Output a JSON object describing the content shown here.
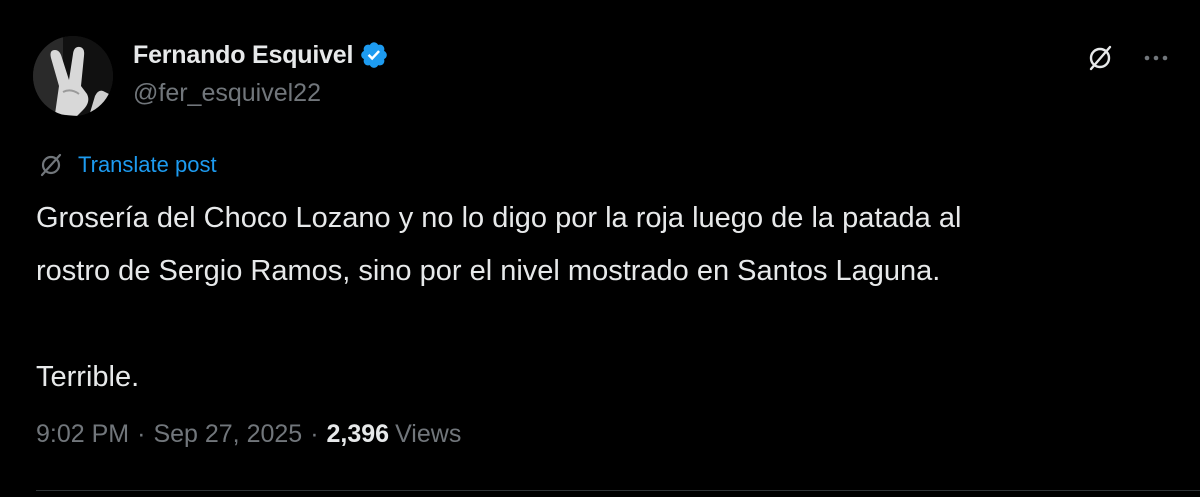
{
  "author": {
    "display_name": "Fernando Esquivel",
    "handle": "@fer_esquivel22",
    "verified": true,
    "verified_color": "#1d9bf0"
  },
  "actions": {
    "grok_icon": "grok-slash-circle-icon",
    "more_icon": "more-horizontal-icon"
  },
  "translate": {
    "label": "Translate post",
    "color": "#1d9bf0"
  },
  "post": {
    "line1": "Grosería del Choco Lozano y no lo digo por la roja luego de la patada al",
    "line2": "rostro de Sergio Ramos, sino por el nivel mostrado en Santos Laguna.",
    "line3": "Terrible."
  },
  "meta": {
    "time": "9:02 PM",
    "separator": "·",
    "date": "Sep 27, 2025",
    "views_count": "2,396",
    "views_label": "Views"
  }
}
